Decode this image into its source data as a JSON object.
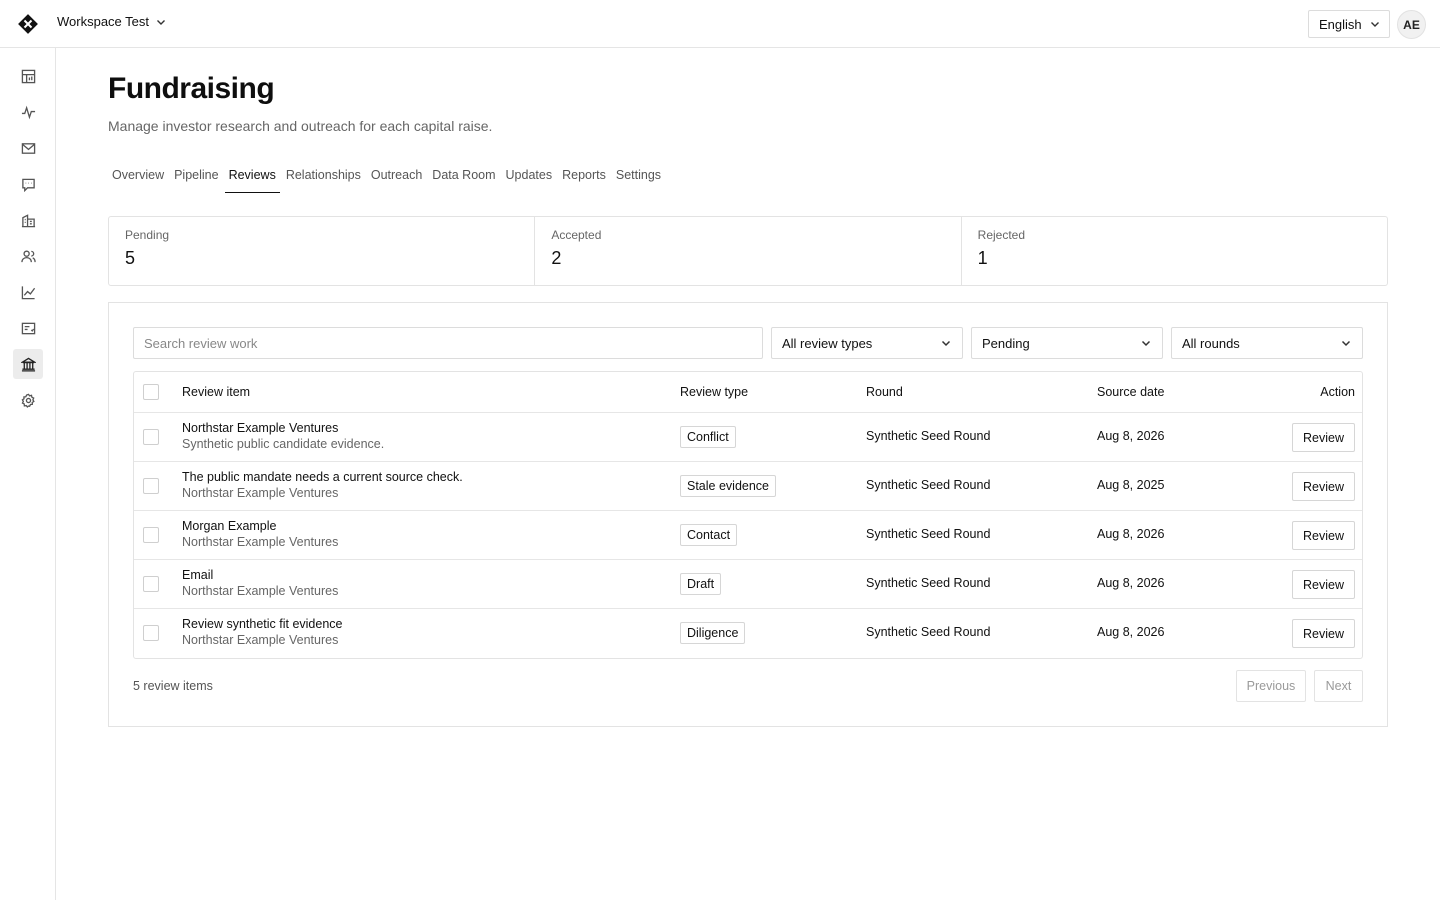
{
  "topbar": {
    "workspace": "Workspace Test",
    "language": "English",
    "avatar_initials": "AE"
  },
  "sidebar": {
    "items": [
      {
        "icon": "dashboard-icon"
      },
      {
        "icon": "activity-icon"
      },
      {
        "icon": "mail-icon"
      },
      {
        "icon": "chat-icon"
      },
      {
        "icon": "building-icon"
      },
      {
        "icon": "people-icon"
      },
      {
        "icon": "chart-icon"
      },
      {
        "icon": "card-icon"
      },
      {
        "icon": "bank-icon",
        "active": true
      },
      {
        "icon": "gear-icon"
      }
    ]
  },
  "page": {
    "title": "Fundraising",
    "subtitle": "Manage investor research and outreach for each capital raise."
  },
  "tabs": [
    {
      "label": "Overview"
    },
    {
      "label": "Pipeline"
    },
    {
      "label": "Reviews",
      "active": true
    },
    {
      "label": "Relationships"
    },
    {
      "label": "Outreach"
    },
    {
      "label": "Data Room"
    },
    {
      "label": "Updates"
    },
    {
      "label": "Reports"
    },
    {
      "label": "Settings"
    }
  ],
  "stats": [
    {
      "label": "Pending",
      "value": "5"
    },
    {
      "label": "Accepted",
      "value": "2"
    },
    {
      "label": "Rejected",
      "value": "1"
    }
  ],
  "filters": {
    "search_placeholder": "Search review work",
    "review_type": "All review types",
    "status": "Pending",
    "round": "All rounds"
  },
  "table": {
    "headers": {
      "item": "Review item",
      "type": "Review type",
      "round": "Round",
      "date": "Source date",
      "action": "Action"
    },
    "rows": [
      {
        "title": "Northstar Example Ventures",
        "sub": "Synthetic public candidate evidence.",
        "type": "Conflict",
        "round": "Synthetic Seed Round",
        "date": "Aug 8, 2026",
        "action": "Review"
      },
      {
        "title": "The public mandate needs a current source check.",
        "sub": "Northstar Example Ventures",
        "type": "Stale evidence",
        "round": "Synthetic Seed Round",
        "date": "Aug 8, 2025",
        "action": "Review"
      },
      {
        "title": "Morgan Example",
        "sub": "Northstar Example Ventures",
        "type": "Contact",
        "round": "Synthetic Seed Round",
        "date": "Aug 8, 2026",
        "action": "Review"
      },
      {
        "title": "Email",
        "sub": "Northstar Example Ventures",
        "type": "Draft",
        "round": "Synthetic Seed Round",
        "date": "Aug 8, 2026",
        "action": "Review"
      },
      {
        "title": "Review synthetic fit evidence",
        "sub": "Northstar Example Ventures",
        "type": "Diligence",
        "round": "Synthetic Seed Round",
        "date": "Aug 8, 2026",
        "action": "Review"
      }
    ]
  },
  "footer": {
    "count": "5 review items",
    "previous": "Previous",
    "next": "Next"
  }
}
